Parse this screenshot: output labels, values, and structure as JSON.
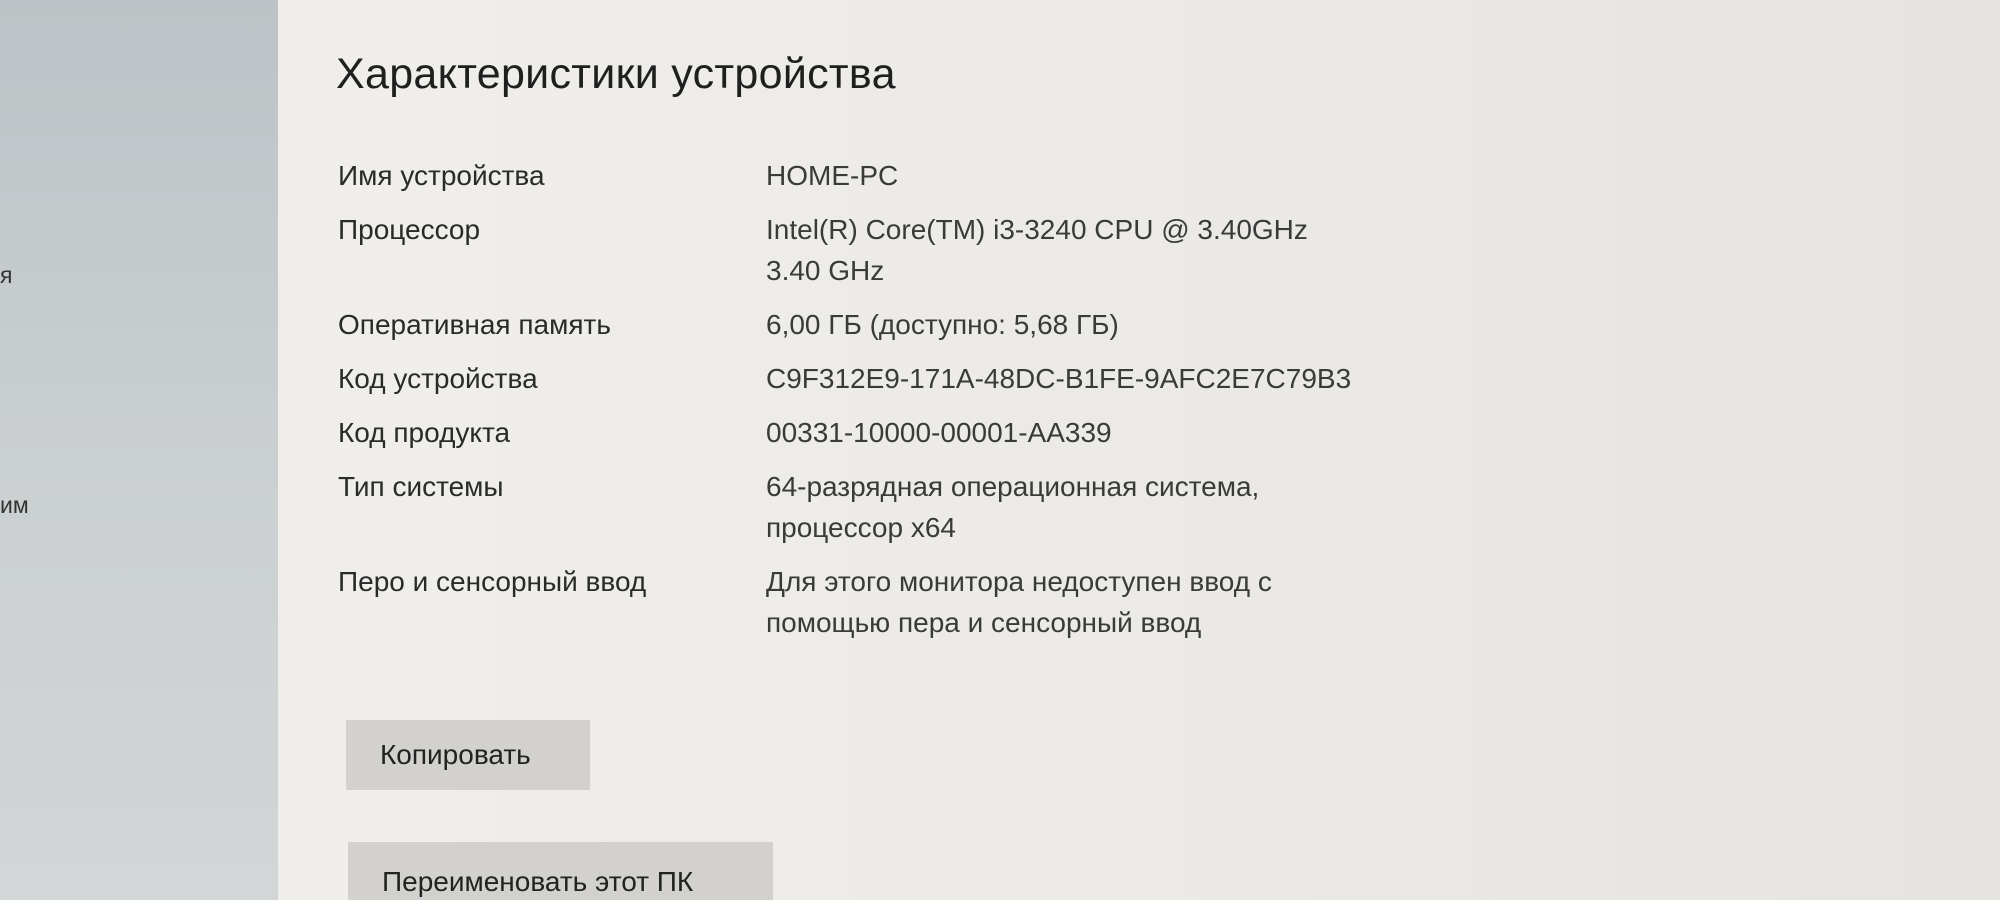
{
  "sidebar": {
    "fragments": [
      {
        "text": "я"
      },
      {
        "text": "им"
      }
    ]
  },
  "section": {
    "title": "Характеристики устройства"
  },
  "specs": [
    {
      "label": "Имя устройства",
      "value": "HOME-PC"
    },
    {
      "label": "Процессор",
      "value": "Intel(R) Core(TM) i3-3240 CPU @ 3.40GHz\n3.40 GHz"
    },
    {
      "label": "Оперативная память",
      "value": "6,00 ГБ (доступно: 5,68 ГБ)"
    },
    {
      "label": "Код устройства",
      "value": "C9F312E9-171A-48DC-B1FE-9AFC2E7C79B3"
    },
    {
      "label": "Код продукта",
      "value": "00331-10000-00001-AA339"
    },
    {
      "label": "Тип системы",
      "value": "64-разрядная операционная система,\nпроцессор x64"
    },
    {
      "label": "Перо и сенсорный ввод",
      "value": "Для этого монитора недоступен ввод с\nпомощью пера и сенсорный ввод"
    }
  ],
  "buttons": {
    "copy_label": "Копировать",
    "rename_label": "Переименовать этот ПК"
  }
}
